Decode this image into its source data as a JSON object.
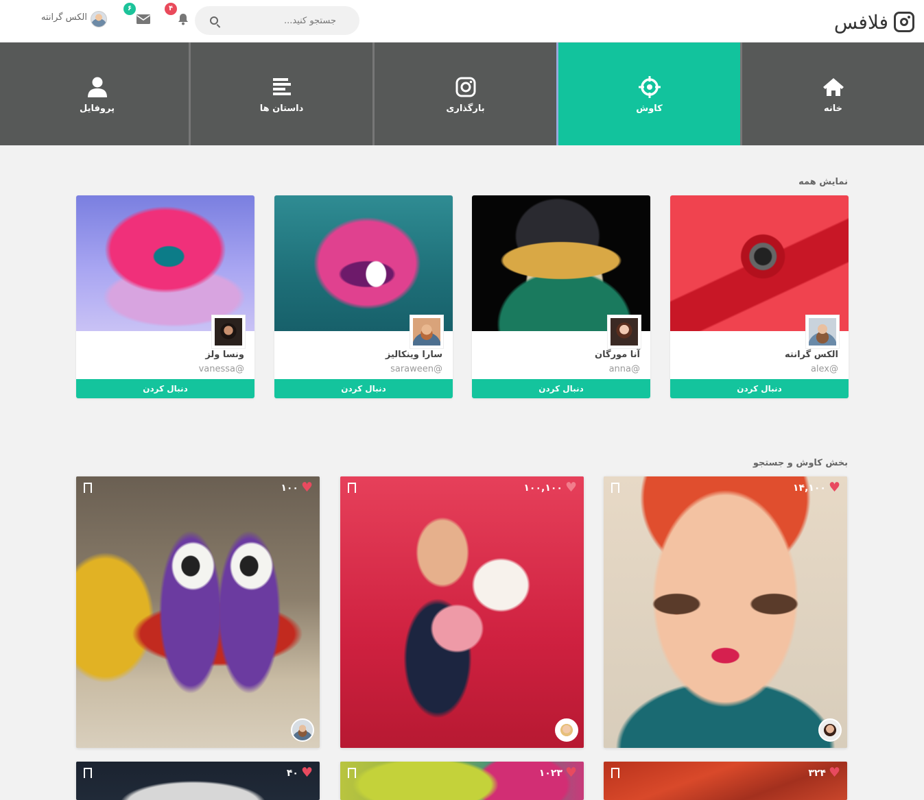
{
  "brand": {
    "name": "فلافس",
    "icon": "instagram-icon"
  },
  "search": {
    "placeholder": "جستجو کنید..."
  },
  "header": {
    "notifications_count": "۴",
    "messages_count": "۶",
    "user_name": "الکس گرانته"
  },
  "nav": {
    "items": [
      {
        "label": "خانه",
        "icon": "home-icon"
      },
      {
        "label": "کاوش",
        "icon": "explore-crosshair-icon",
        "active": true
      },
      {
        "label": "بارگذاری",
        "icon": "camera-icon"
      },
      {
        "label": "داستان ها",
        "icon": "stories-icon"
      },
      {
        "label": "پروفایل",
        "icon": "user-icon"
      }
    ]
  },
  "suggestions": {
    "title": "نمایش همه",
    "follow_label": "دنبال کردن",
    "cards": [
      {
        "name": "الکس گرانته",
        "handle": "alex@"
      },
      {
        "name": "آنا مورگان",
        "handle": "anna@"
      },
      {
        "name": "سارا وینکالیز",
        "handle": "saraween@"
      },
      {
        "name": "ونسا ولز",
        "handle": "vanessa@"
      }
    ]
  },
  "explore": {
    "title": "بخش کاوش و جستجو",
    "posts": [
      {
        "likes": "۱۴,۱۰۰"
      },
      {
        "likes": "۱۰۰,۱۰۰"
      },
      {
        "likes": "۱۰۰"
      },
      {
        "likes": "۳۲۴"
      },
      {
        "likes": "۱۰۲۳"
      },
      {
        "likes": "۴۰"
      }
    ]
  },
  "colors": {
    "accent": "#14c49d",
    "nav_bg": "#575958",
    "heart": "#e84a5f",
    "badge_red": "#e94a5b"
  }
}
